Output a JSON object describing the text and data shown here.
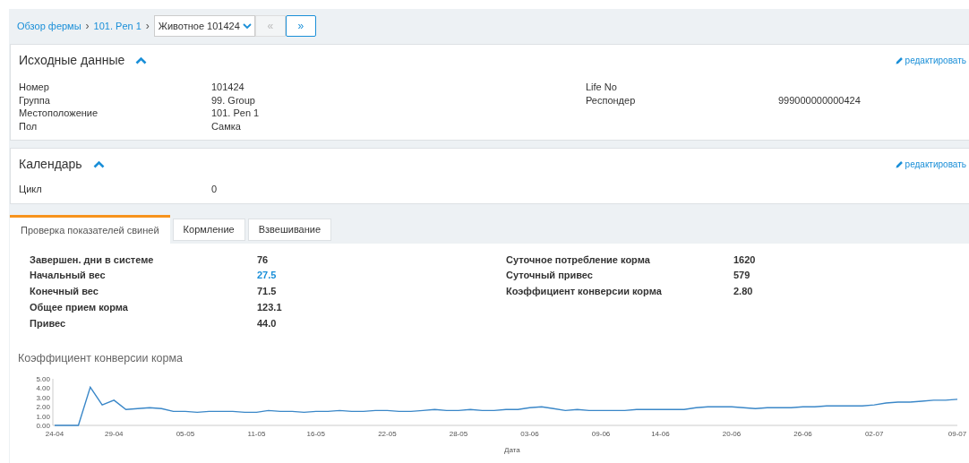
{
  "breadcrumb": {
    "items": [
      {
        "label": "Обзор фермы"
      },
      {
        "label": "101. Pen 1"
      }
    ],
    "separators": [
      "›",
      "›"
    ],
    "animal_select": {
      "value": "Животное 101424"
    },
    "prev_button": {
      "label": "«",
      "disabled": true
    },
    "next_button": {
      "label": "»",
      "disabled": false
    }
  },
  "sections": [
    {
      "title": "Исходные данные",
      "expanded": true,
      "edit_link": "редактировать",
      "left_fields": [
        {
          "label": "Номер",
          "value": "101424"
        },
        {
          "label": "Группа",
          "value": "99. Group"
        },
        {
          "label": "Местоположение",
          "value": "101. Pen 1"
        },
        {
          "label": "Пол",
          "value": "Самка"
        }
      ],
      "right_fields": [
        {
          "label": "Life No"
        },
        {
          "label": "Респондер",
          "value": "999000000000424"
        }
      ]
    },
    {
      "title": "Календарь",
      "expanded": true,
      "edit_link": "редактировать",
      "left_fields": [
        {
          "label": "Цикл",
          "value": "0"
        }
      ]
    }
  ],
  "tabs": [
    {
      "label": "Проверка показателей свиней",
      "selected": true
    },
    {
      "label": "Кормление",
      "selected": false
    },
    {
      "label": "Взвешивание",
      "selected": false
    }
  ],
  "stats_left": [
    {
      "label": "Завершен. дни в системе",
      "value": "76",
      "kind": "text"
    },
    {
      "label": "Начальный вес",
      "value": "27.5",
      "kind": "link"
    },
    {
      "label": "Конечный вес",
      "value": "71.5",
      "kind": "text"
    },
    {
      "label": "Общее прием корма",
      "value": "123.1",
      "kind": "text"
    },
    {
      "label": "Привес",
      "value": "44.0",
      "kind": "text"
    }
  ],
  "stats_right": [
    {
      "label": "Суточное потребление корма",
      "value": "1620",
      "kind": "text"
    },
    {
      "label": "Суточный привес",
      "value": "579",
      "kind": "text"
    },
    {
      "label": "Коэффициент конверсии корма",
      "value": "2.80",
      "kind": "text"
    }
  ],
  "chart": {
    "title": "Коэффициент конверсии корма",
    "chart_data": {
      "type": "line",
      "xlabel": "Дата",
      "categories": [
        "24-04",
        null,
        null,
        null,
        null,
        "29-04",
        null,
        null,
        null,
        null,
        null,
        "05-05",
        null,
        null,
        null,
        null,
        null,
        "11-05",
        null,
        null,
        null,
        null,
        "16-05",
        null,
        null,
        null,
        null,
        null,
        "22-05",
        null,
        null,
        null,
        null,
        null,
        "28-05",
        null,
        null,
        null,
        null,
        null,
        "03-06",
        null,
        null,
        null,
        null,
        null,
        "09-06",
        null,
        null,
        null,
        null,
        "14-06",
        null,
        null,
        null,
        null,
        null,
        "20-06",
        null,
        null,
        null,
        null,
        null,
        "26-06",
        null,
        null,
        null,
        null,
        null,
        "02-07",
        null,
        null,
        null,
        null,
        null,
        null,
        "09-07"
      ],
      "series": [
        {
          "color": "#3a87c8",
          "values": [
            0,
            0,
            0,
            4.1,
            2.2,
            2.7,
            1.7,
            1.8,
            1.9,
            1.8,
            1.5,
            1.5,
            1.4,
            1.5,
            1.5,
            1.5,
            1.4,
            1.4,
            1.6,
            1.5,
            1.5,
            1.4,
            1.5,
            1.5,
            1.6,
            1.5,
            1.5,
            1.6,
            1.6,
            1.5,
            1.5,
            1.6,
            1.7,
            1.6,
            1.6,
            1.7,
            1.6,
            1.6,
            1.7,
            1.7,
            1.9,
            2.0,
            1.8,
            1.6,
            1.7,
            1.6,
            1.6,
            1.6,
            1.6,
            1.7,
            1.7,
            1.7,
            1.7,
            1.7,
            1.9,
            2.0,
            2.0,
            2.0,
            1.9,
            1.8,
            1.9,
            1.9,
            1.9,
            2.0,
            2.0,
            2.1,
            2.1,
            2.1,
            2.1,
            2.2,
            2.4,
            2.5,
            2.5,
            2.6,
            2.7,
            2.7,
            2.8
          ]
        }
      ],
      "ylim": [
        0,
        5
      ],
      "yticks": [
        {
          "value": 0,
          "label": "0.00"
        },
        {
          "value": 1,
          "label": "1.00"
        },
        {
          "value": 2,
          "label": "2.00"
        },
        {
          "value": 3,
          "label": "3.00"
        },
        {
          "value": 4,
          "label": "4.00"
        },
        {
          "value": 5,
          "label": "5.00"
        }
      ]
    }
  }
}
